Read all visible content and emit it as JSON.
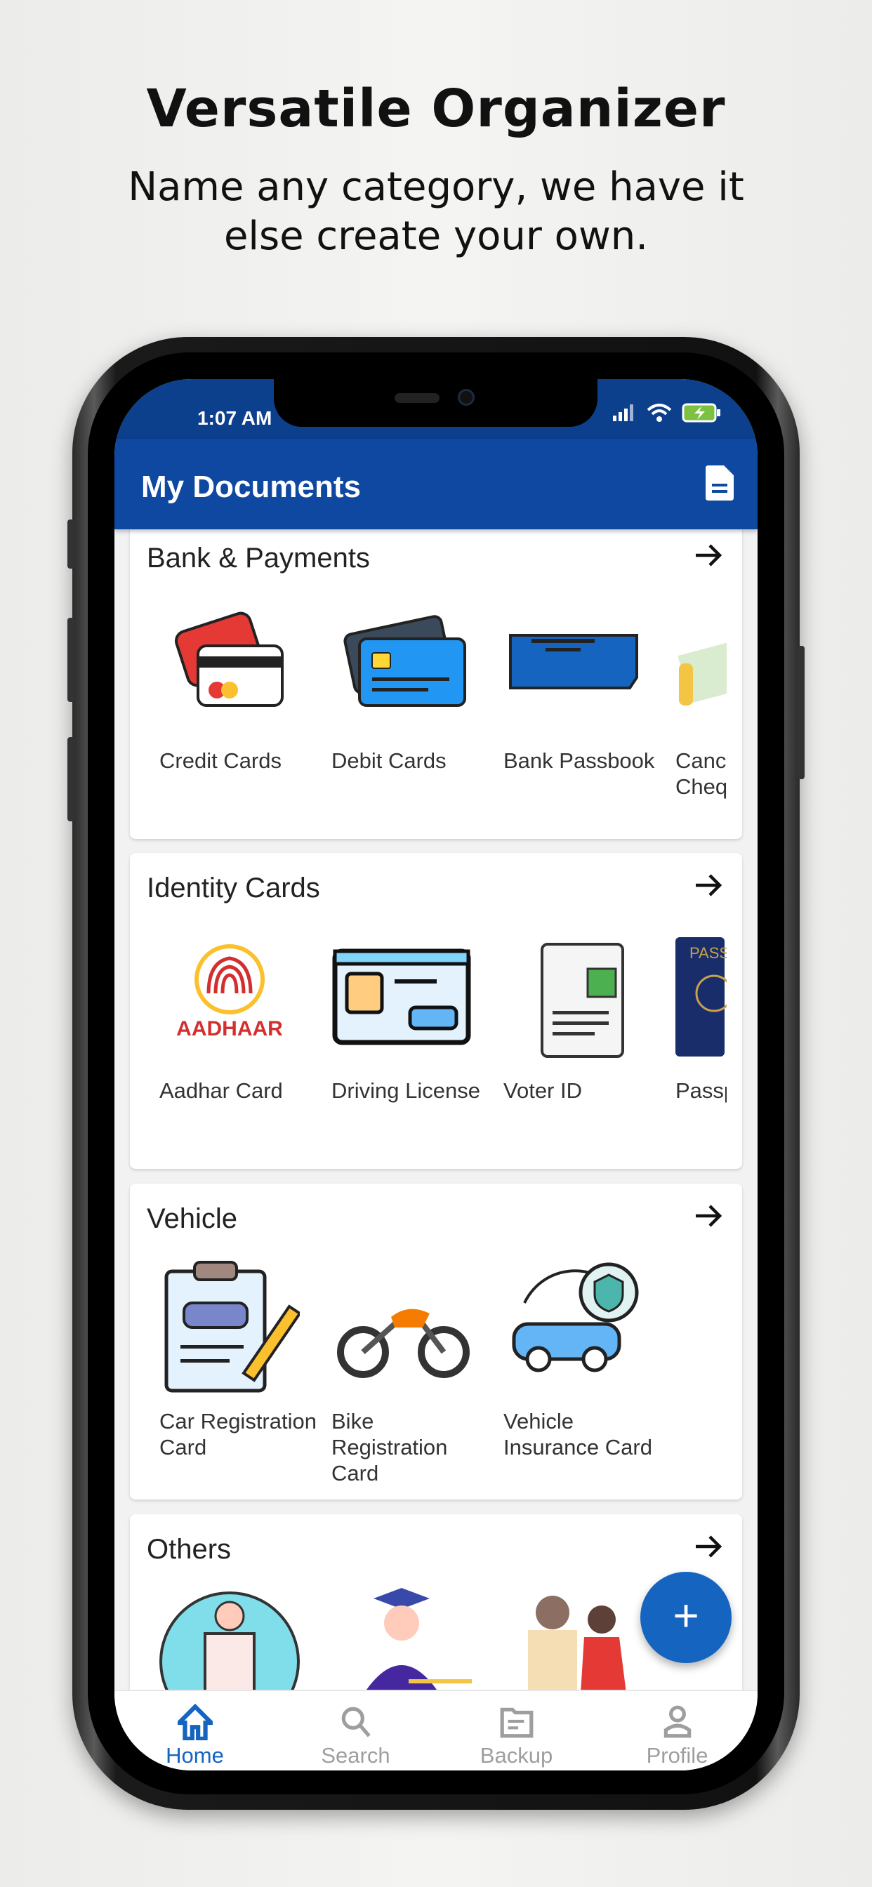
{
  "promo": {
    "title": "Versatile Organizer",
    "subtitle_line1": "Name any category, we have it",
    "subtitle_line2": "else create your own."
  },
  "status": {
    "time": "1:07 AM"
  },
  "appbar": {
    "title": "My Documents",
    "action_icon": "document-icon"
  },
  "colors": {
    "primary": "#0f48a0",
    "status": "#0c3f8c",
    "accent": "#1565c0",
    "inactive": "#9e9e9e"
  },
  "categories": [
    {
      "title": "Bank & Payments",
      "items": [
        {
          "label": "Credit Cards",
          "icon": "credit-card"
        },
        {
          "label": "Debit Cards",
          "icon": "debit-card"
        },
        {
          "label": "Bank Passbook",
          "icon": "passbook"
        },
        {
          "label": "Cancelled Cheque",
          "icon": "cheque"
        }
      ]
    },
    {
      "title": "Identity Cards",
      "items": [
        {
          "label": "Aadhar Card",
          "icon": "aadhaar",
          "logo_text": "AADHAAR"
        },
        {
          "label": "Driving License",
          "icon": "license"
        },
        {
          "label": "Voter ID",
          "icon": "voter"
        },
        {
          "label": "Passport",
          "icon": "passport",
          "logo_text": "PASS"
        }
      ]
    },
    {
      "title": "Vehicle",
      "items": [
        {
          "label": "Car Registration Card",
          "icon": "car-reg"
        },
        {
          "label": "Bike Registration Card",
          "icon": "bike"
        },
        {
          "label": "Vehicle Insurance Card",
          "icon": "insurance"
        }
      ]
    },
    {
      "title": "Others",
      "items": [
        {
          "label": "",
          "icon": "birth"
        },
        {
          "label": "",
          "icon": "graduate"
        },
        {
          "label": "",
          "icon": "marriage"
        }
      ]
    }
  ],
  "fab": {
    "label": "+"
  },
  "nav": [
    {
      "label": "Home",
      "icon": "home",
      "active": true
    },
    {
      "label": "Search",
      "icon": "search",
      "active": false
    },
    {
      "label": "Backup",
      "icon": "folder",
      "active": false
    },
    {
      "label": "Profile",
      "icon": "person",
      "active": false
    }
  ]
}
